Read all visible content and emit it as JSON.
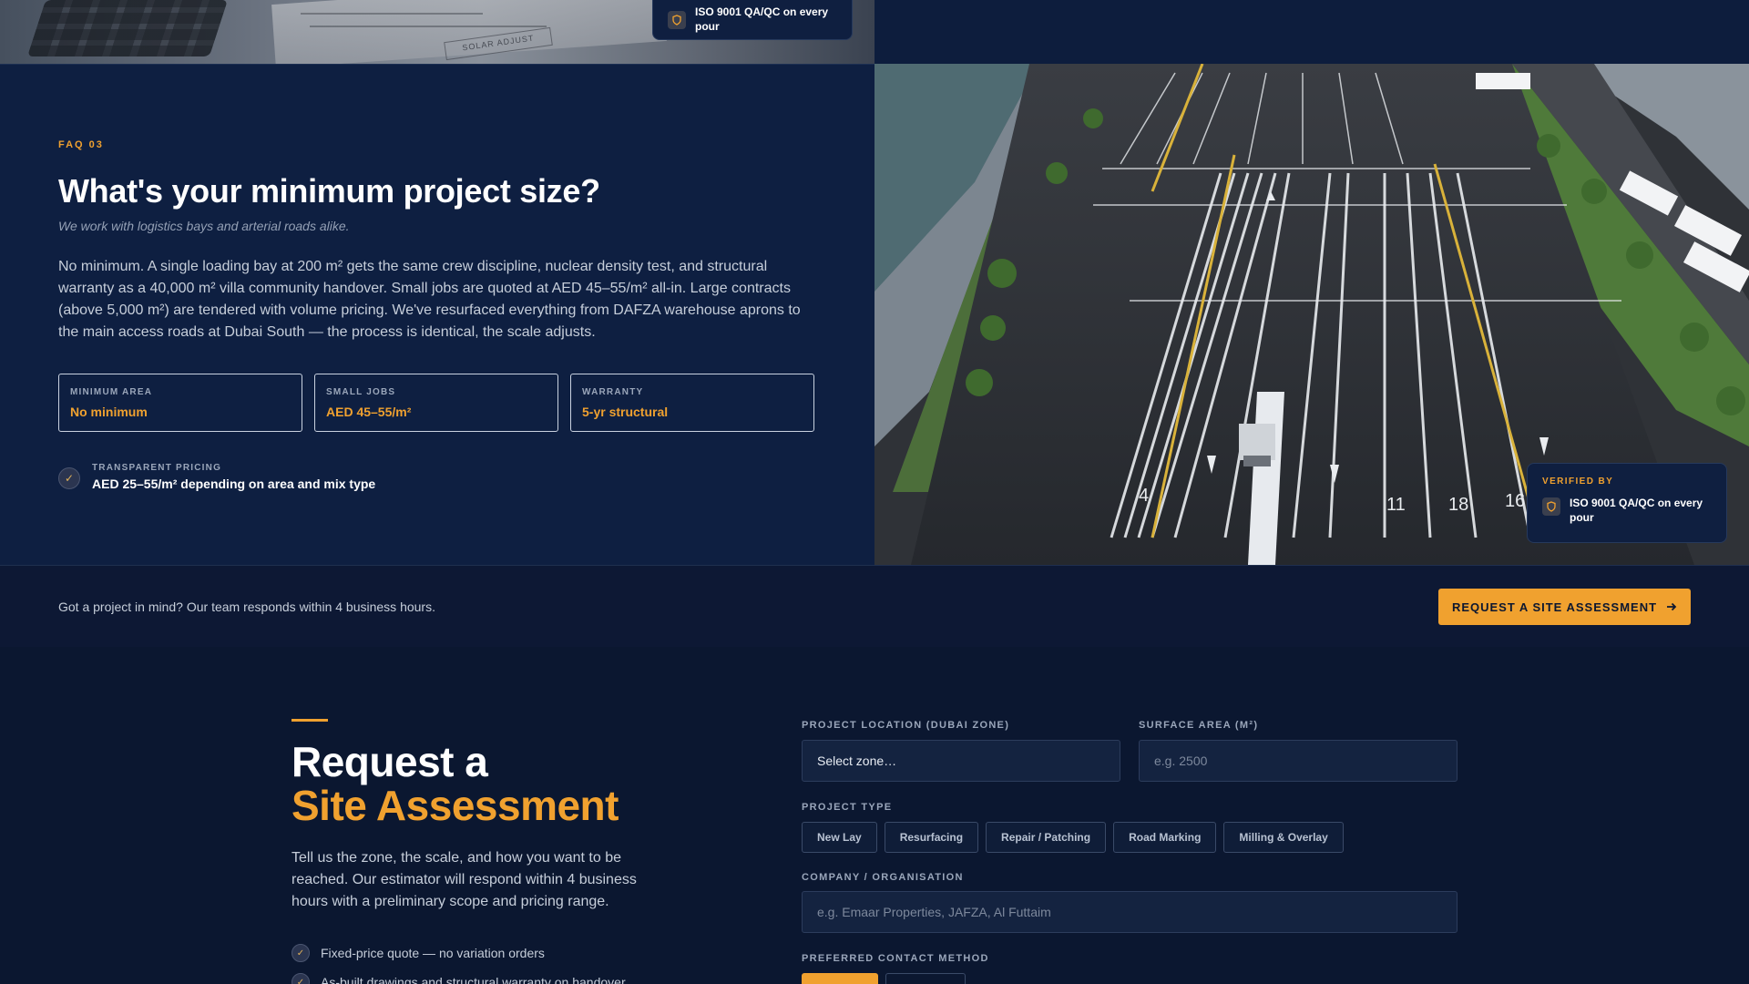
{
  "top_badge": {
    "text": "ISO 9001 QA/QC on every pour",
    "icon": "shield-icon"
  },
  "top_photo": {
    "stamp_text": "SOLAR ADJUST"
  },
  "faq": {
    "kicker": "FAQ 03",
    "title": "What's your minimum project size?",
    "subtitle": "We work with logistics bays and arterial roads alike.",
    "body": "No minimum. A single loading bay at 200 m² gets the same crew discipline, nuclear density test, and structural warranty as a 40,000 m² villa community handover. Small jobs are quoted at AED 45–55/m² all-in. Large contracts (above 5,000 m²) are tendered with volume pricing. We've resurfaced everything from DAFZA warehouse aprons to the main access roads at Dubai South — the process is identical, the scale adjusts.",
    "stats": [
      {
        "label": "MINIMUM AREA",
        "value": "No minimum"
      },
      {
        "label": "SMALL JOBS",
        "value": "AED 45–55/m²"
      },
      {
        "label": "WARRANTY",
        "value": "5-yr structural"
      }
    ],
    "pricing": {
      "label": "TRANSPARENT PRICING",
      "value": "AED 25–55/m² depending on area and mix type"
    }
  },
  "aerial": {
    "bay_numbers": [
      "4",
      "11",
      "18",
      "16"
    ],
    "verified": {
      "label": "VERIFIED BY",
      "text": "ISO 9001 QA/QC on every pour"
    }
  },
  "cta": {
    "text": "Got a project in mind? Our team responds within 4 business hours.",
    "button_label": "REQUEST A SITE ASSESSMENT",
    "button_icon": "arrow-right-icon"
  },
  "request": {
    "title_line1": "Request a",
    "title_line2": "Site Assessment",
    "description": "Tell us the zone, the scale, and how you want to be reached. Our estimator will respond within 4 business hours with a preliminary scope and pricing range.",
    "checklist": [
      "Fixed-price quote — no variation orders",
      "As-built drawings and structural warranty on handover"
    ],
    "form": {
      "location_label": "PROJECT LOCATION (DUBAI ZONE)",
      "location_value": "Select zone…",
      "area_label": "SURFACE AREA (M²)",
      "area_placeholder": "e.g. 2500",
      "type_label": "PROJECT TYPE",
      "types": [
        "New Lay",
        "Resurfacing",
        "Repair / Patching",
        "Road Marking",
        "Milling & Overlay"
      ],
      "company_label": "COMPANY / ORGANISATION",
      "company_placeholder": "e.g. Emaar Properties, JAFZA, Al Futtaim",
      "contact_label": "PREFERRED CONTACT METHOD"
    }
  },
  "colors": {
    "accent": "#f0a12f",
    "navy": "#0e1f41",
    "page_bg": "#0b1730"
  }
}
